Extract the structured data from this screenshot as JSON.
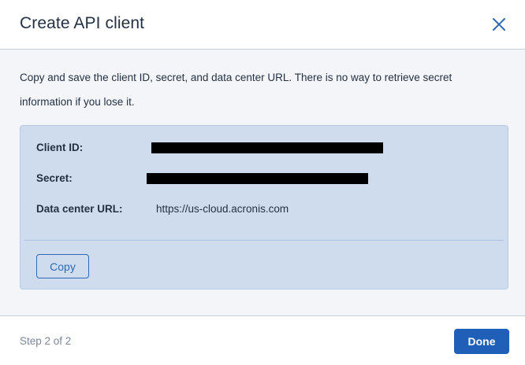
{
  "dialog": {
    "title": "Create API client",
    "close_icon": "close-icon"
  },
  "body": {
    "intro_text": "Copy and save the client ID, secret, and data center URL. There is no way to retrieve secret information if you lose it.",
    "fields": {
      "client_id_label": "Client ID:",
      "secret_label": "Secret:",
      "data_center_label": "Data center URL:",
      "data_center_value": "https://us-cloud.acronis.com"
    },
    "copy_label": "Copy"
  },
  "footer": {
    "step_text": "Step 2 of 2",
    "done_label": "Done"
  },
  "colors": {
    "accent": "#1f5fb8",
    "info_box_bg": "#cfdcee",
    "text": "#243143"
  }
}
